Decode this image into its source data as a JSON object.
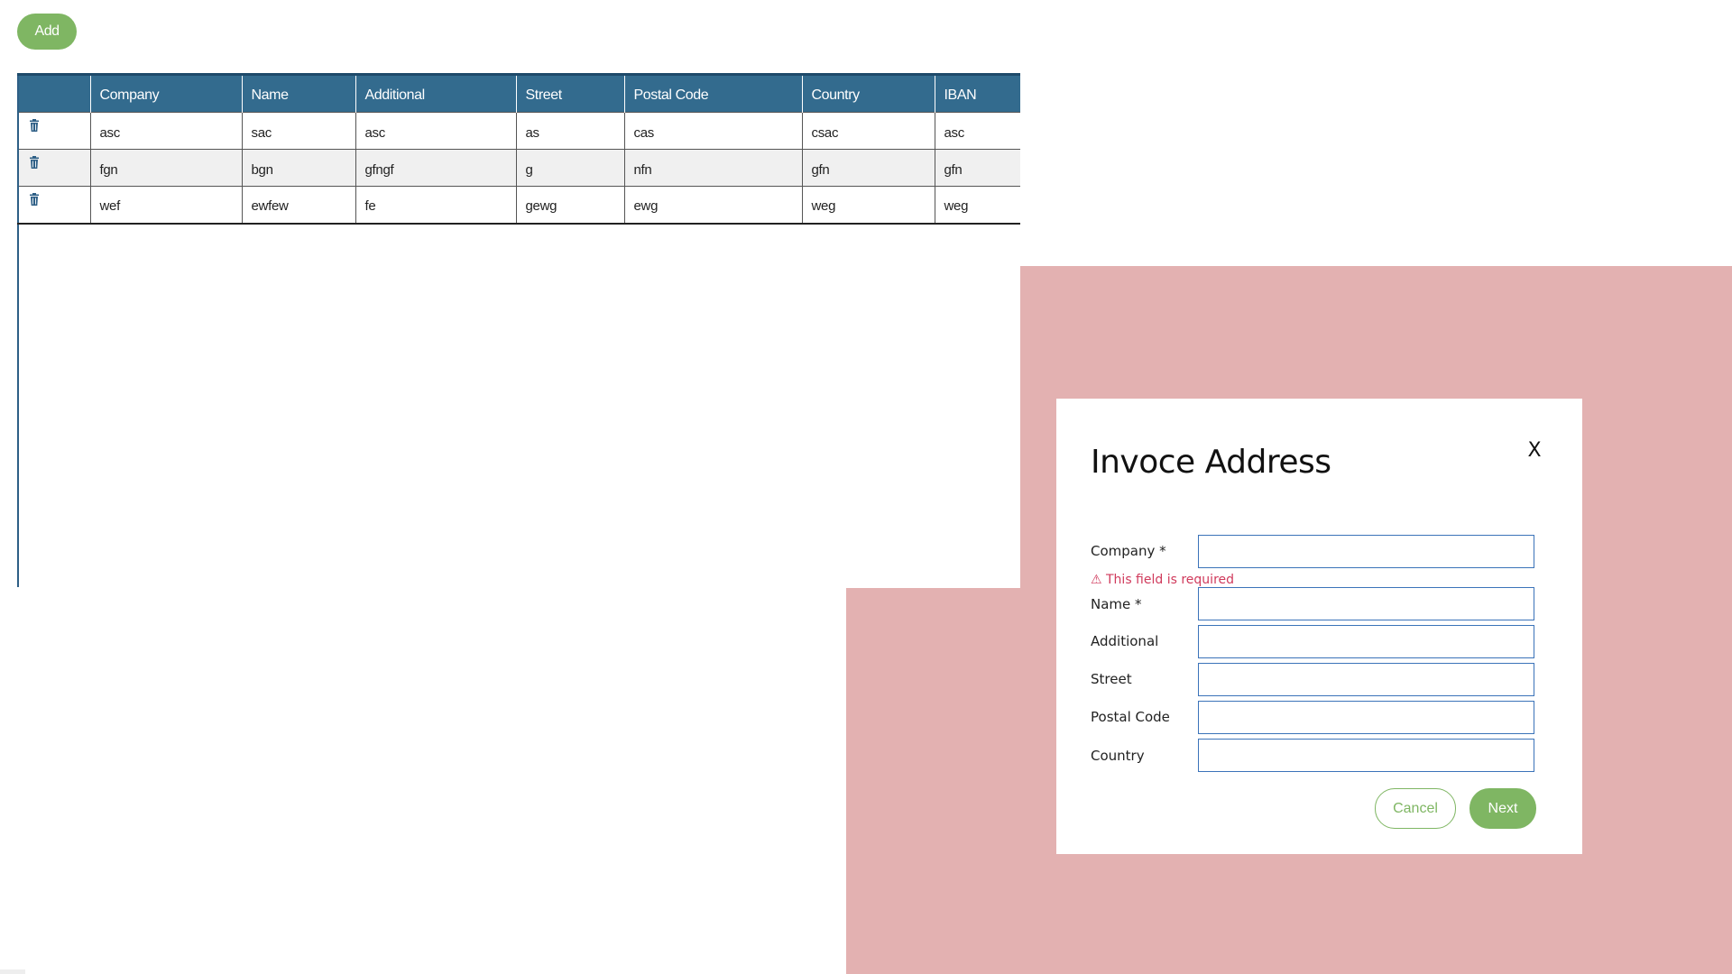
{
  "toolbar": {
    "add_label": "Add"
  },
  "table": {
    "columns": [
      "",
      "Company",
      "Name",
      "Additional",
      "Street",
      "Postal Code",
      "Country",
      "IBAN"
    ],
    "rows": [
      [
        "asc",
        "sac",
        "asc",
        "as",
        "cas",
        "csac",
        "asc"
      ],
      [
        "fgn",
        "bgn",
        "gfngf",
        "g",
        "nfn",
        "gfn",
        "gfn"
      ],
      [
        "wef",
        "ewfew",
        "fe",
        "gewg",
        "ewg",
        "weg",
        "weg"
      ]
    ],
    "row_icon": "trash-icon"
  },
  "dialog": {
    "title": "Invoce Address",
    "close_label": "X",
    "fields": [
      {
        "label": "Company *",
        "value": "",
        "placeholder": ""
      },
      {
        "label": "Name *",
        "value": "",
        "placeholder": ""
      },
      {
        "label": "Additional",
        "value": "",
        "placeholder": ""
      },
      {
        "label": "Street",
        "value": "",
        "placeholder": ""
      },
      {
        "label": "Postal Code",
        "value": "",
        "placeholder": ""
      },
      {
        "label": "Country",
        "value": "",
        "placeholder": ""
      }
    ],
    "error": "⚠ This field is required",
    "cancel_label": "Cancel",
    "next_label": "Next"
  },
  "colors": {
    "accent_green": "#7fb663",
    "header_blue": "#336b8e",
    "overlay_pink": "#e3b1b1",
    "input_border": "#3b73b9",
    "error_red": "#d03a5c"
  }
}
